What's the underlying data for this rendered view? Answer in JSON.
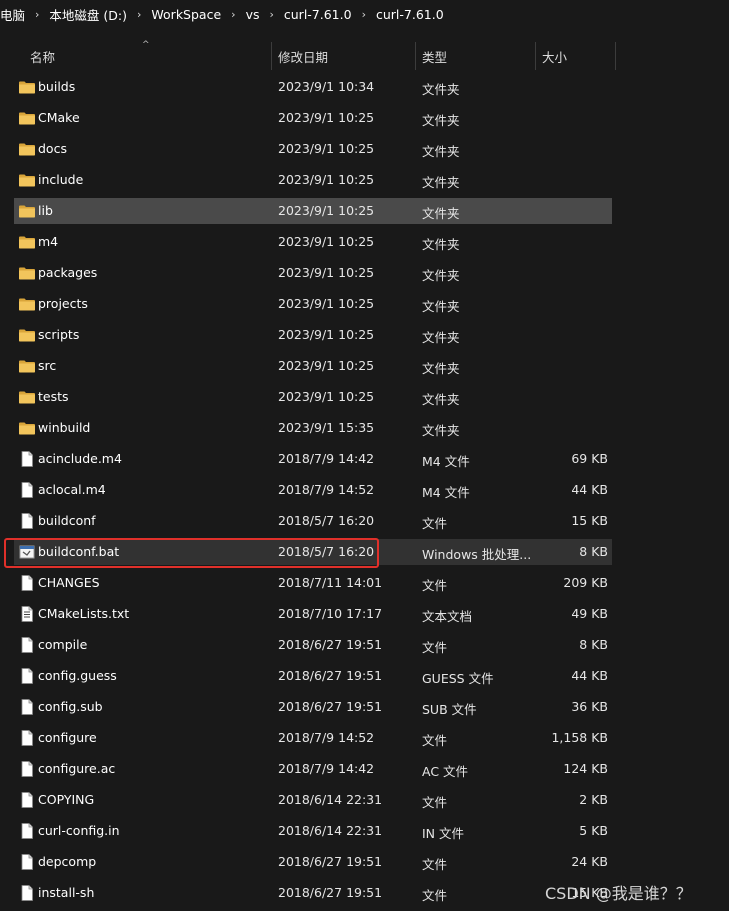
{
  "breadcrumb": [
    "电脑",
    "本地磁盘 (D:)",
    "WorkSpace",
    "vs",
    "curl-7.61.0",
    "curl-7.61.0"
  ],
  "columns": {
    "name": "名称",
    "date": "修改日期",
    "type": "类型",
    "size": "大小"
  },
  "files": [
    {
      "name": "builds",
      "date": "2023/9/1 10:34",
      "type": "文件夹",
      "size": "",
      "kind": "folder"
    },
    {
      "name": "CMake",
      "date": "2023/9/1 10:25",
      "type": "文件夹",
      "size": "",
      "kind": "folder"
    },
    {
      "name": "docs",
      "date": "2023/9/1 10:25",
      "type": "文件夹",
      "size": "",
      "kind": "folder"
    },
    {
      "name": "include",
      "date": "2023/9/1 10:25",
      "type": "文件夹",
      "size": "",
      "kind": "folder"
    },
    {
      "name": "lib",
      "date": "2023/9/1 10:25",
      "type": "文件夹",
      "size": "",
      "kind": "folder",
      "selected": true
    },
    {
      "name": "m4",
      "date": "2023/9/1 10:25",
      "type": "文件夹",
      "size": "",
      "kind": "folder"
    },
    {
      "name": "packages",
      "date": "2023/9/1 10:25",
      "type": "文件夹",
      "size": "",
      "kind": "folder"
    },
    {
      "name": "projects",
      "date": "2023/9/1 10:25",
      "type": "文件夹",
      "size": "",
      "kind": "folder"
    },
    {
      "name": "scripts",
      "date": "2023/9/1 10:25",
      "type": "文件夹",
      "size": "",
      "kind": "folder"
    },
    {
      "name": "src",
      "date": "2023/9/1 10:25",
      "type": "文件夹",
      "size": "",
      "kind": "folder"
    },
    {
      "name": "tests",
      "date": "2023/9/1 10:25",
      "type": "文件夹",
      "size": "",
      "kind": "folder"
    },
    {
      "name": "winbuild",
      "date": "2023/9/1 15:35",
      "type": "文件夹",
      "size": "",
      "kind": "folder"
    },
    {
      "name": "acinclude.m4",
      "date": "2018/7/9 14:42",
      "type": "M4 文件",
      "size": "69 KB",
      "kind": "file"
    },
    {
      "name": "aclocal.m4",
      "date": "2018/7/9 14:52",
      "type": "M4 文件",
      "size": "44 KB",
      "kind": "file"
    },
    {
      "name": "buildconf",
      "date": "2018/5/7 16:20",
      "type": "文件",
      "size": "15 KB",
      "kind": "file"
    },
    {
      "name": "buildconf.bat",
      "date": "2018/5/7 16:20",
      "type": "Windows 批处理...",
      "size": "8 KB",
      "kind": "batch",
      "hovered": true
    },
    {
      "name": "CHANGES",
      "date": "2018/7/11 14:01",
      "type": "文件",
      "size": "209 KB",
      "kind": "file"
    },
    {
      "name": "CMakeLists.txt",
      "date": "2018/7/10 17:17",
      "type": "文本文档",
      "size": "49 KB",
      "kind": "text"
    },
    {
      "name": "compile",
      "date": "2018/6/27 19:51",
      "type": "文件",
      "size": "8 KB",
      "kind": "file"
    },
    {
      "name": "config.guess",
      "date": "2018/6/27 19:51",
      "type": "GUESS 文件",
      "size": "44 KB",
      "kind": "file"
    },
    {
      "name": "config.sub",
      "date": "2018/6/27 19:51",
      "type": "SUB 文件",
      "size": "36 KB",
      "kind": "file"
    },
    {
      "name": "configure",
      "date": "2018/7/9 14:52",
      "type": "文件",
      "size": "1,158 KB",
      "kind": "file"
    },
    {
      "name": "configure.ac",
      "date": "2018/7/9 14:42",
      "type": "AC 文件",
      "size": "124 KB",
      "kind": "file"
    },
    {
      "name": "COPYING",
      "date": "2018/6/14 22:31",
      "type": "文件",
      "size": "2 KB",
      "kind": "file"
    },
    {
      "name": "curl-config.in",
      "date": "2018/6/14 22:31",
      "type": "IN 文件",
      "size": "5 KB",
      "kind": "file"
    },
    {
      "name": "depcomp",
      "date": "2018/6/27 19:51",
      "type": "文件",
      "size": "24 KB",
      "kind": "file"
    },
    {
      "name": "install-sh",
      "date": "2018/6/27 19:51",
      "type": "文件",
      "size": "15 KB",
      "kind": "file"
    }
  ],
  "watermark": "CSDN @我是谁？？",
  "colors": {
    "background": "#191919",
    "selected_row": "#4a4a4a",
    "hover_row": "#323232",
    "folder": "#f2c55c",
    "highlight_box": "#e0302a"
  }
}
